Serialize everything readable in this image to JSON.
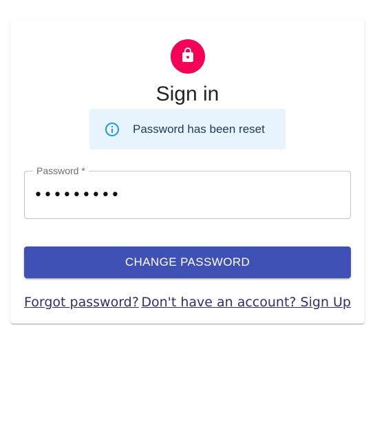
{
  "heading": "Sign in",
  "alert": {
    "message": "Password has been reset",
    "icon": "info-icon",
    "color": "#2196f3",
    "background": "#e8f4fd"
  },
  "password_field": {
    "label": "Password *",
    "value": "•••••••••"
  },
  "submit": {
    "label": "CHANGE PASSWORD",
    "color": "#3f51b5"
  },
  "links": {
    "forgot": "Forgot password?",
    "signup": "Don't have an account? Sign Up"
  },
  "avatar": {
    "icon": "lock-icon",
    "color": "#f50057"
  }
}
